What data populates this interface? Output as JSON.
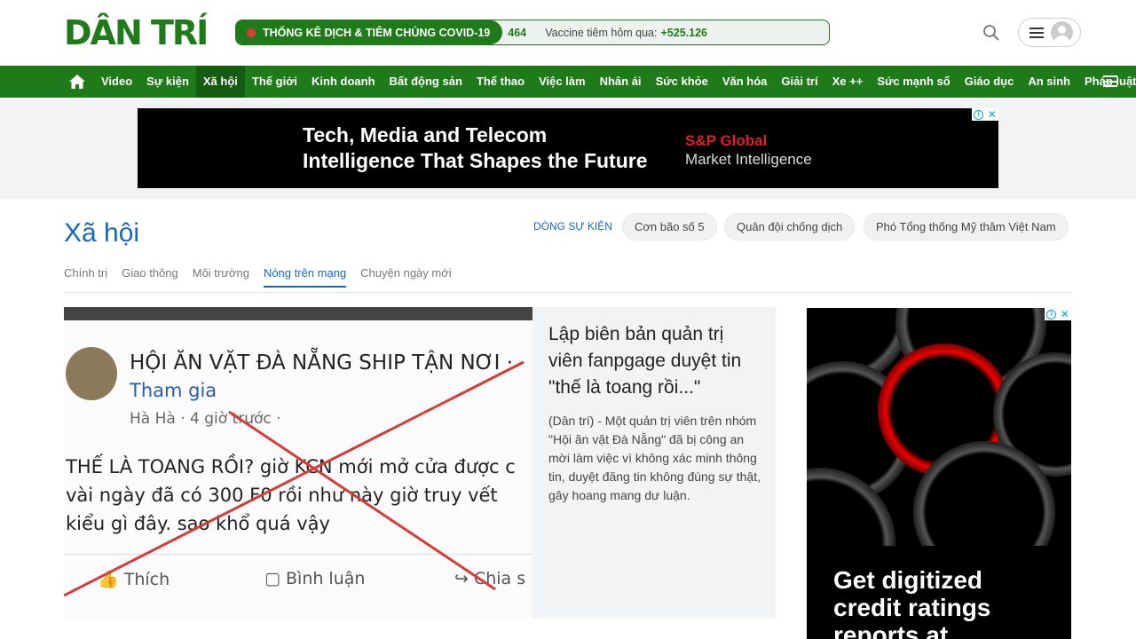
{
  "header": {
    "logo": "DÂN TRÍ",
    "covid": {
      "title": "THỐNG KÊ DỊCH & TIÊM CHỦNG COVID-19",
      "ticker_value": "464",
      "vaccine_label": "Vaccine tiêm hôm qua:",
      "vaccine_value": "+525.126"
    }
  },
  "nav": {
    "items": [
      "Video",
      "Sự kiện",
      "Xã hội",
      "Thế giới",
      "Kinh doanh",
      "Bất động sản",
      "Thể thao",
      "Việc làm",
      "Nhân ái",
      "Sức khỏe",
      "Văn hóa",
      "Giải trí",
      "Xe ++",
      "Sức mạnh số",
      "Giáo dục",
      "An sinh",
      "Pháp luật"
    ],
    "active_index": 2
  },
  "top_ad": {
    "headline_line1": "Tech, Media and Telecom",
    "headline_line2": "Intelligence That Shapes the Future",
    "brand": "S&P Global",
    "brand_sub": "Market Intelligence"
  },
  "section": {
    "title": "Xã hội",
    "events_label": "DÒNG SỰ KIỆN",
    "event_tags": [
      "Cơn bão số 5",
      "Quân đội chống dịch",
      "Phó Tổng thống Mỹ thăm Việt Nam"
    ],
    "subnav": [
      "Chính trị",
      "Giao thông",
      "Môi trường",
      "Nóng trên mạng",
      "Chuyện ngày mới"
    ],
    "subnav_active_index": 3
  },
  "featured": {
    "image": {
      "group_name": "HỘI ĂN VẶT ĐÀ NẴNG SHIP TẬN NƠI ·",
      "join": "Tham gia",
      "meta": "Hà Hà · 4 giờ trước ·",
      "post_line1": "THẾ LÀ TOANG RỒI? giờ KCN mới mở cửa được c",
      "post_line2": "vài ngày đã có 300 F0 rồi như này giờ truy vết",
      "post_line3": "kiểu gì đây. sao khổ quá vậy",
      "like": "Thích",
      "comment": "Bình luận",
      "share": "Chia s"
    },
    "title": "Lập biên bản quản trị viên fanpgage duyệt tin \"thế là toang rồi...\"",
    "description": "(Dân trí) - Một quản trị viên trên nhóm \"Hội ăn vặt Đà Nẵng\" đã bị công an mời làm việc vì không xác minh thông tin, duyệt đăng tin không đúng sự thật, gây hoang mang dư luận."
  },
  "side_ad": {
    "line1": "Get digitized",
    "line2": "credit ratings",
    "line3": "reports at"
  }
}
